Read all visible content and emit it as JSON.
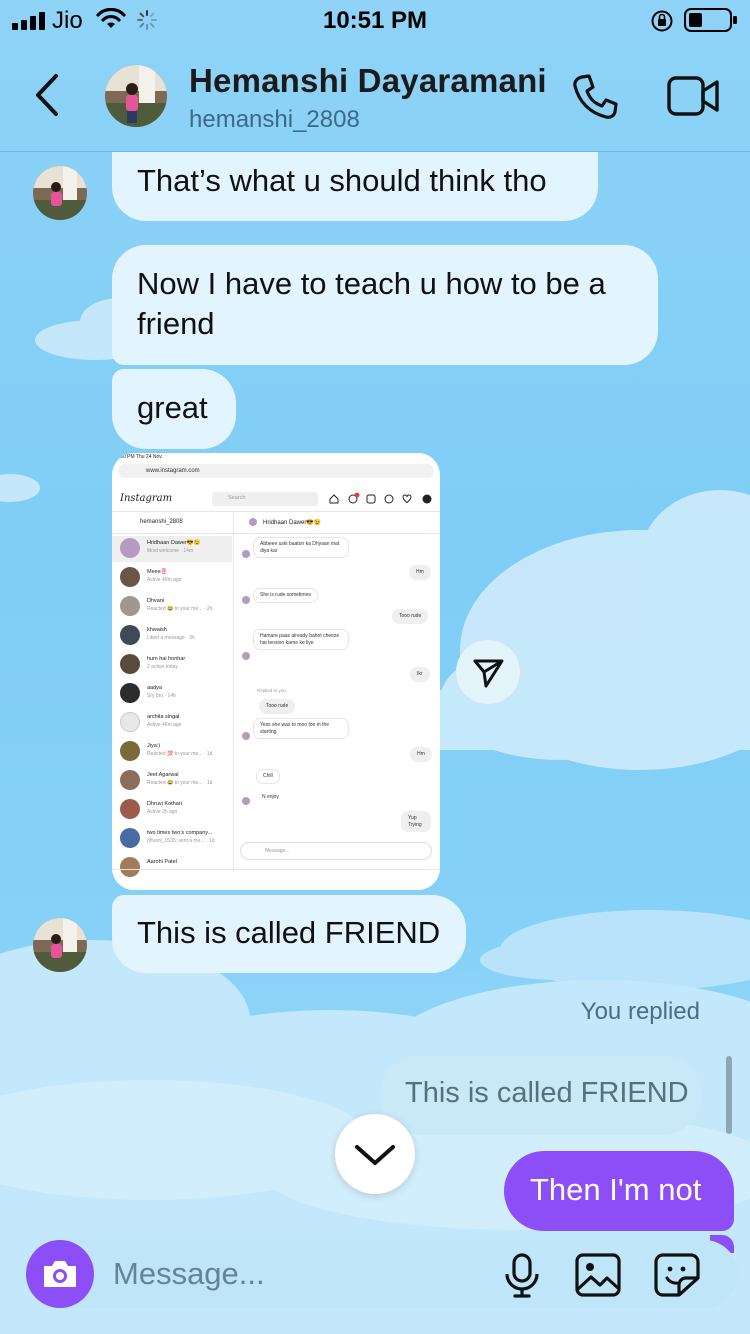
{
  "status_bar": {
    "carrier": "Jio",
    "time": "10:51 PM"
  },
  "header": {
    "name": "Hemanshi Dayaramani",
    "username": "hemanshi_2808"
  },
  "messages": [
    {
      "text": "That’s what u should think tho",
      "from": "them"
    },
    {
      "text": "Now I have to teach u how to be a friend",
      "from": "them"
    },
    {
      "text": "great",
      "from": "them"
    },
    {
      "text": "This is called FRIEND",
      "from": "them"
    }
  ],
  "reply": {
    "label": "You replied",
    "quoted": "This is called FRIEND",
    "text": "Then I'm not"
  },
  "composer": {
    "placeholder": "Message..."
  },
  "screenshot": {
    "status_time": "7:50 PM  Thu 24 Nov",
    "url": "www.instagram.com",
    "logo": "Instagram",
    "search": "Search",
    "account": "hemanshi_2808",
    "chat_title": "Hridhaan Dawer😎😉",
    "threads": [
      {
        "name": "Hridhaan Dawer😎😉",
        "sub": "Most welcome · 14m"
      },
      {
        "name": "Meee‼️",
        "sub": "Active 49m ago"
      },
      {
        "name": "Dhvani",
        "sub": "Reacted 😂 to your me... · 2h"
      },
      {
        "name": "khwaish",
        "sub": "Liked a message · 3h"
      },
      {
        "name": "hum hai honhar",
        "sub": "2 active today"
      },
      {
        "name": "aadya",
        "sub": "Sry bro · 14h"
      },
      {
        "name": "archita singal",
        "sub": "Active 46m ago"
      },
      {
        "name": "Jiya:)",
        "sub": "Reacted 💯 to your me... · 1d"
      },
      {
        "name": "Jeet Agarwal",
        "sub": "Reacted 😂 to your me... · 1d"
      },
      {
        "name": "Dhruvi Kothari",
        "sub": "Active 2h ago"
      },
      {
        "name": "two times two’s company...",
        "sub": "dhvani_1533: sent a me... · 1d"
      },
      {
        "name": "Aarohi Patel",
        "sub": ""
      }
    ],
    "chat": [
      {
        "text": "Abbeee uski baaton ka Dhyaan mat diya kar",
        "me": false
      },
      {
        "text": "Hm",
        "me": true
      },
      {
        "text": "She is rude sometimes",
        "me": false
      },
      {
        "text": "Tooo rude",
        "me": true
      },
      {
        "text": "Hamare paas already bahot cheeze hai tension karne ke liye",
        "me": false
      },
      {
        "text": "Ikr",
        "me": true
      },
      {
        "text": "Replied to you",
        "me": false
      },
      {
        "text": "Tooo rude",
        "me": false
      },
      {
        "text": "Yess she was to moo too in the starting",
        "me": false
      },
      {
        "text": "Hm",
        "me": true
      },
      {
        "text": "Chill",
        "me": false
      },
      {
        "text": "N enjoy",
        "me": false
      },
      {
        "text": "Yup Trying",
        "me": true
      }
    ],
    "composer": "Message..."
  },
  "colors": {
    "accent": "#8c4ff7",
    "bubble_them": "#e2f4fd",
    "background": "#86d1f7"
  },
  "icons": [
    "back-icon",
    "phone-icon",
    "video-icon",
    "send-icon",
    "chevron-down-icon",
    "camera-icon",
    "mic-icon",
    "gallery-icon",
    "sticker-icon"
  ]
}
